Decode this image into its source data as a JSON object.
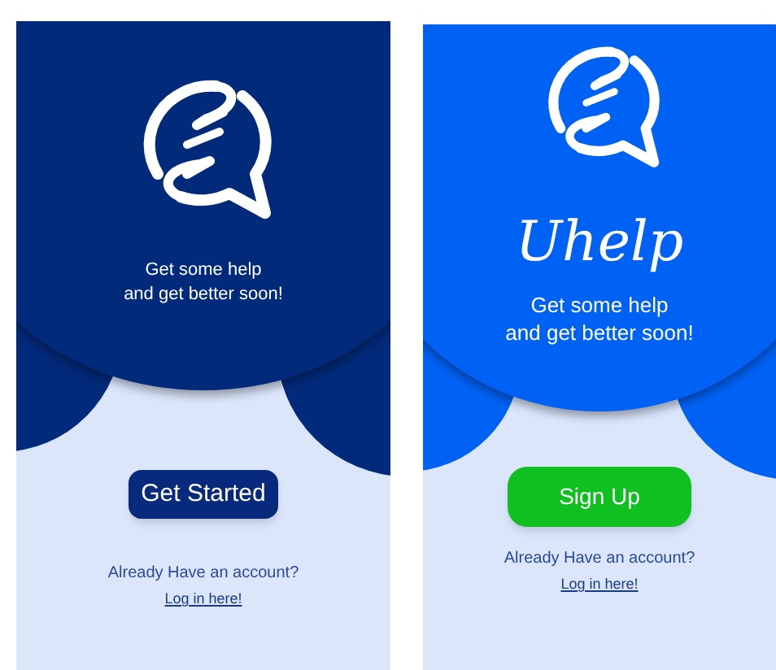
{
  "screens": [
    {
      "color": "#022a7a",
      "tagline": [
        "Get some help",
        "and get better soon!"
      ],
      "button": {
        "label": "Get Started",
        "color": "#082a7c"
      },
      "prompt": "Already Have an account?",
      "link": "Log in here!"
    },
    {
      "color": "#0062f4",
      "brand": "Uhelp",
      "tagline": [
        "Get some help",
        "and get better soon!"
      ],
      "button": {
        "label": "Sign Up",
        "color": "#10c020"
      },
      "prompt": "Already Have an account?",
      "link": "Log in here!"
    }
  ]
}
